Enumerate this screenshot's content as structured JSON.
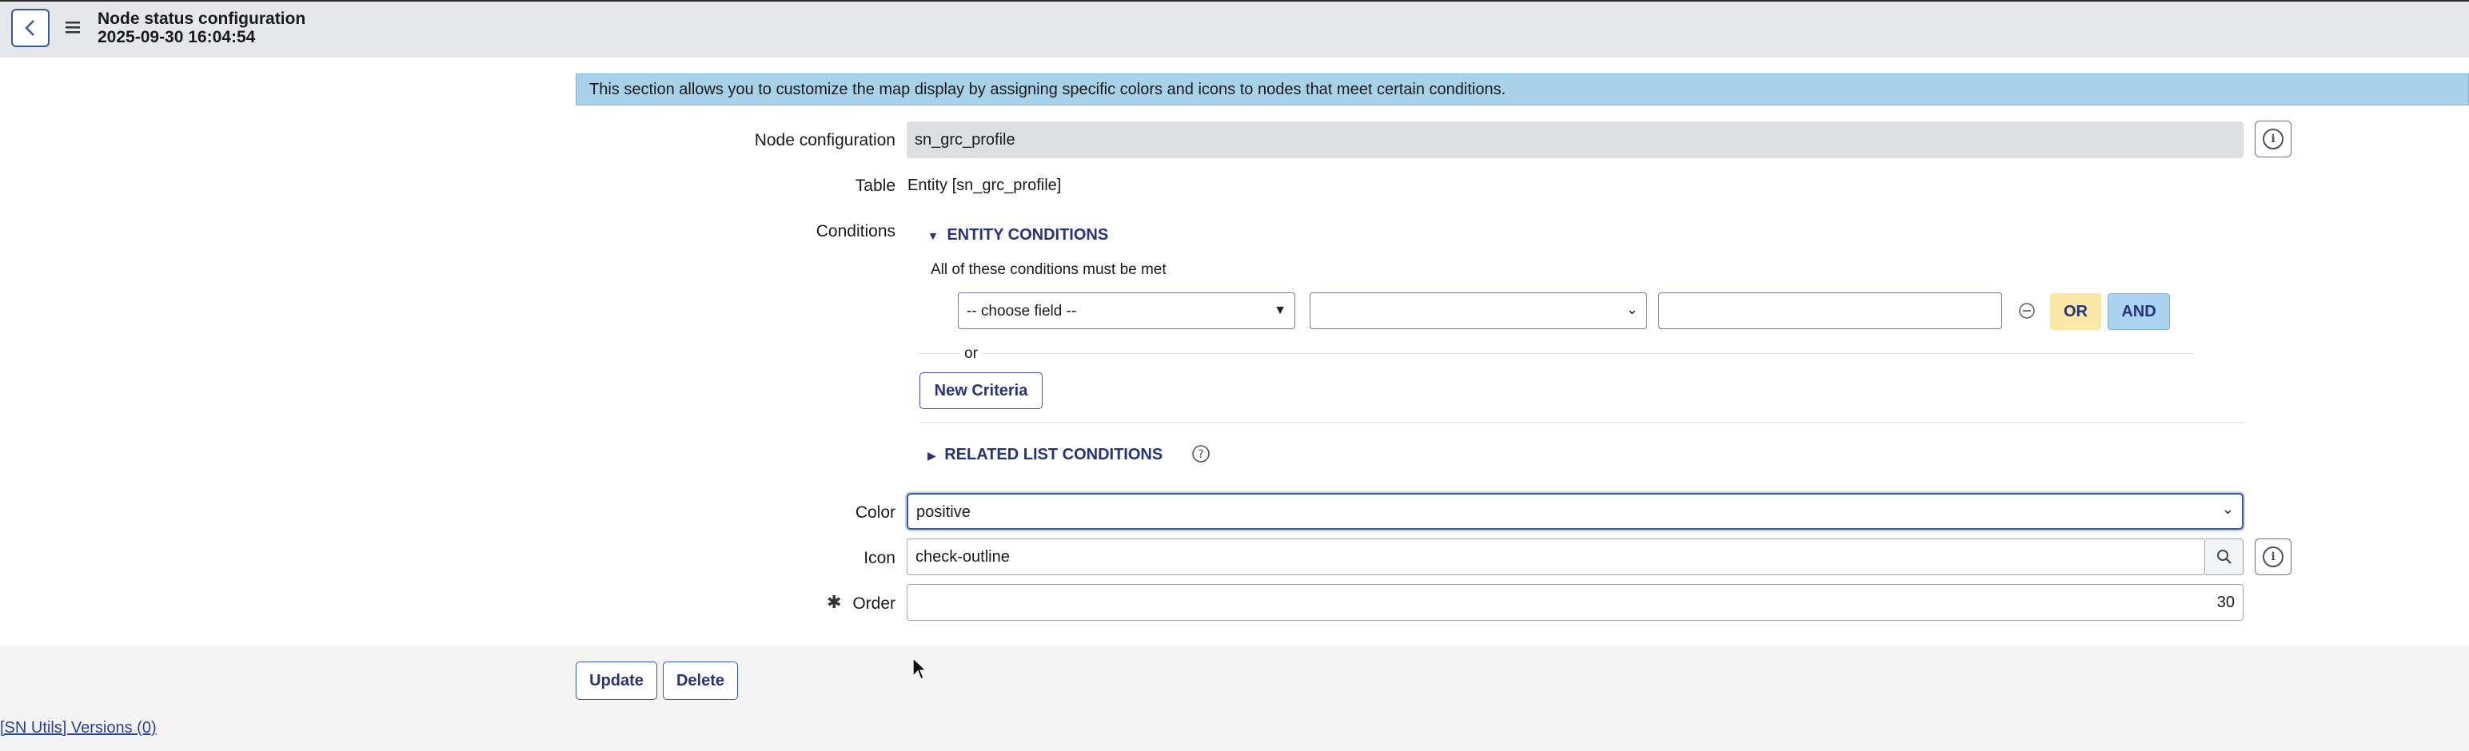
{
  "header": {
    "title": "Node status configuration",
    "timestamp": "2025-09-30 16:04:54"
  },
  "banner": {
    "text": "This section allows you to customize the map display by assigning specific colors and icons to nodes that meet certain conditions."
  },
  "form": {
    "node_configuration": {
      "label": "Node configuration",
      "value": "sn_grc_profile"
    },
    "table": {
      "label": "Table",
      "value": "Entity [sn_grc_profile]"
    },
    "conditions": {
      "label": "Conditions",
      "entity_heading": "ENTITY CONDITIONS",
      "all_must_be_met": "All of these conditions must be met",
      "field_select": "-- choose field --",
      "operator_select": "",
      "value_input": "",
      "or_button": "OR",
      "and_button": "AND",
      "or_separator": "or",
      "new_criteria": "New Criteria",
      "related_heading": "RELATED LIST CONDITIONS"
    },
    "color": {
      "label": "Color",
      "value": "positive"
    },
    "icon": {
      "label": "Icon",
      "value": "check-outline"
    },
    "order": {
      "label": "Order",
      "required_mark": "✱",
      "value": "30"
    }
  },
  "actions": {
    "update": "Update",
    "delete": "Delete"
  },
  "footer": {
    "sn_utils_link": "[SN Utils] Versions (0)"
  },
  "colors": {
    "banner_bg": "#a8d2ea",
    "or_bg": "#fbe8a6",
    "and_bg": "#a9d3ef",
    "link": "#26327a"
  }
}
